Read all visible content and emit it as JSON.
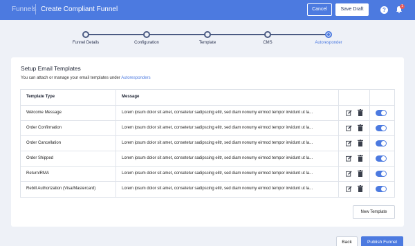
{
  "header": {
    "breadcrumb_root": "Funnels",
    "title": "Create Compliant Funnel",
    "cancel_label": "Cancel",
    "save_draft_label": "Save Draft",
    "help_icon": "?",
    "notification_count": "1"
  },
  "stepper": {
    "steps": [
      {
        "label": "Funnel Details",
        "active": false
      },
      {
        "label": "Configuration",
        "active": false
      },
      {
        "label": "Template",
        "active": false
      },
      {
        "label": "CMS",
        "active": false
      },
      {
        "label": "Autoresponder",
        "active": true
      }
    ]
  },
  "card": {
    "title": "Setup Email Templates",
    "subtitle_prefix": "You can attach or manage your email templates under ",
    "subtitle_link": "Autoresponders"
  },
  "table": {
    "columns": [
      "Template Type",
      "Message"
    ],
    "rows": [
      {
        "type": "Welcome Message",
        "message": "Lorem ipsum dolor sit amet, consetetur sadipscing elitr, sed diam nonumy eirmod tempor invidunt ut la...",
        "enabled": true
      },
      {
        "type": "Order Confirmation",
        "message": "Lorem ipsum dolor sit amet, consetetur sadipscing elitr, sed diam nonumy eirmod tempor invidunt ut la...",
        "enabled": true
      },
      {
        "type": "Order Cancellation",
        "message": "Lorem ipsum dolor sit amet, consetetur sadipscing elitr, sed diam nonumy eirmod tempor invidunt ut la...",
        "enabled": true
      },
      {
        "type": "Order Shipped",
        "message": "Lorem ipsum dolor sit amet, consetetur sadipscing elitr, sed diam nonumy eirmod tempor invidunt ut la...",
        "enabled": true
      },
      {
        "type": "Return/RMA",
        "message": "Lorem ipsum dolor sit amet, consetetur sadipscing elitr, sed diam nonumy eirmod tempor invidunt ut la...",
        "enabled": true
      },
      {
        "type": "Rebill Authorization (Visa/Mastercard)",
        "message": "Lorem ipsum dolor sit amet, consetetur sadipscing elitr, sed diam nonumy eirmod tempor invidunt ut la...",
        "enabled": true
      }
    ]
  },
  "new_template_label": "New Template",
  "footer": {
    "back_label": "Back",
    "publish_label": "Publish Funnel"
  },
  "colors": {
    "accent": "#4c7ae0",
    "background": "#eef1f7",
    "stepper_line": "#4a5a82"
  },
  "icons": {
    "help": "help-icon",
    "notifications": "bell-icon",
    "edit": "edit-icon",
    "delete": "trash-icon"
  }
}
